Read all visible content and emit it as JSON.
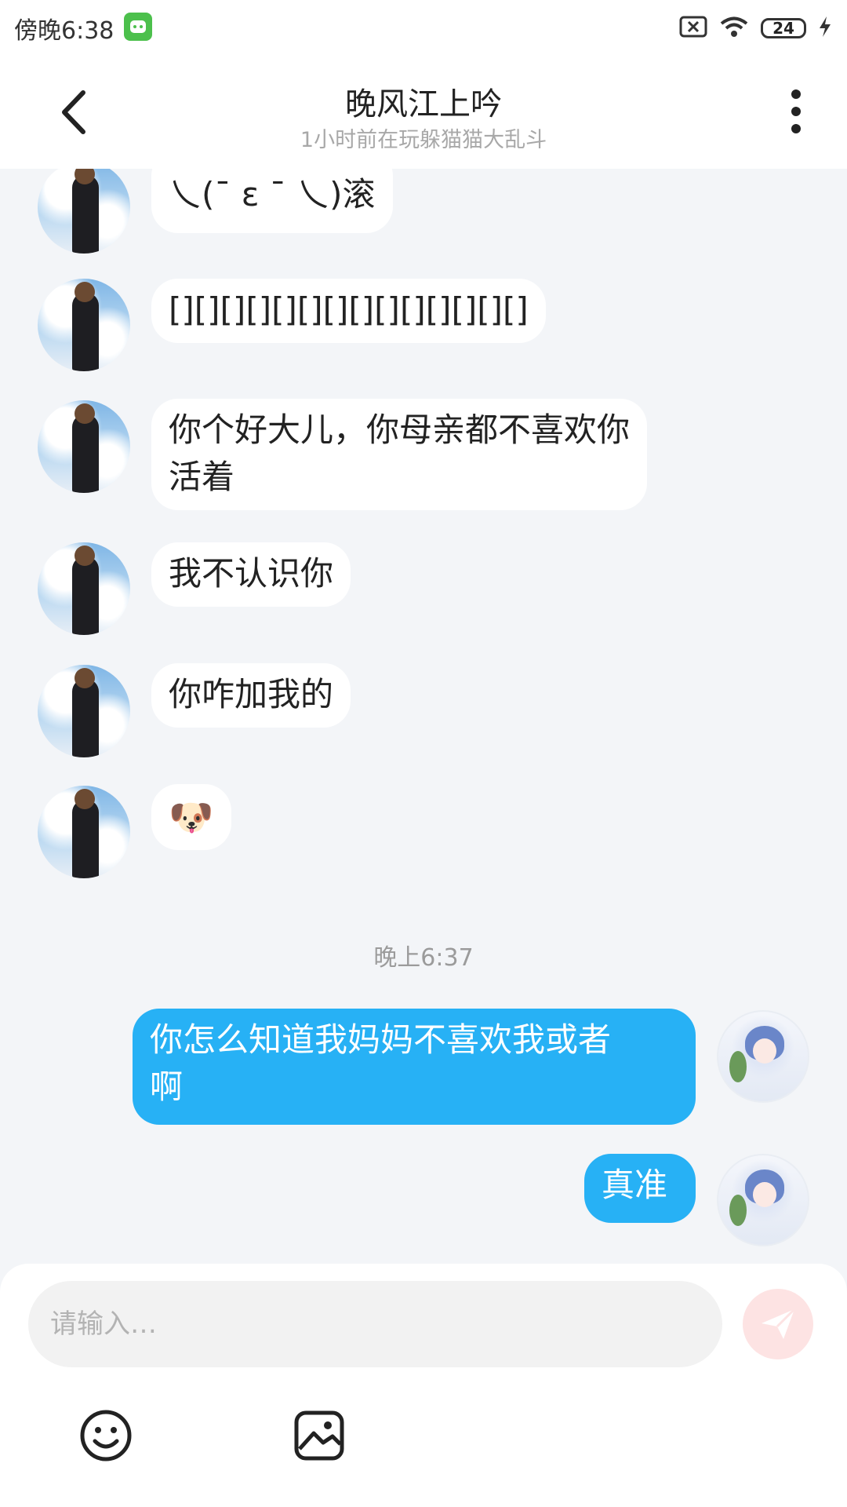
{
  "status_bar": {
    "time": "傍晚6:38",
    "battery": "24"
  },
  "header": {
    "title": "晚风江上吟",
    "subtitle": "1小时前在玩躲猫猫大乱斗"
  },
  "messages": [
    {
      "sender": "other",
      "text": "乀(ˉ ε ˉ 乀)滚"
    },
    {
      "sender": "other",
      "text": "[][][][][][][][][][][][][][]"
    },
    {
      "sender": "other",
      "lines": [
        "你个好大儿，你母亲都不喜欢你",
        "活着"
      ]
    },
    {
      "sender": "other",
      "text": "我不认识你"
    },
    {
      "sender": "other",
      "text": "你咋加我的"
    },
    {
      "sender": "other",
      "text": "🐶"
    },
    {
      "timestamp": "晚上6:37"
    },
    {
      "sender": "me",
      "lines": [
        "你怎么知道我妈妈不喜欢我或者",
        "啊"
      ]
    },
    {
      "sender": "me",
      "text": "真准"
    }
  ],
  "input": {
    "placeholder": "请输入…"
  },
  "icons": {
    "back": "back-arrow-icon",
    "more": "more-vertical-icon",
    "send": "send-icon",
    "emoji": "emoji-icon",
    "image": "image-icon"
  },
  "colors": {
    "my_bubble": "#27b1f5",
    "other_bubble": "#ffffff",
    "background": "#f3f5f8",
    "send_button": "#fde3e3"
  }
}
